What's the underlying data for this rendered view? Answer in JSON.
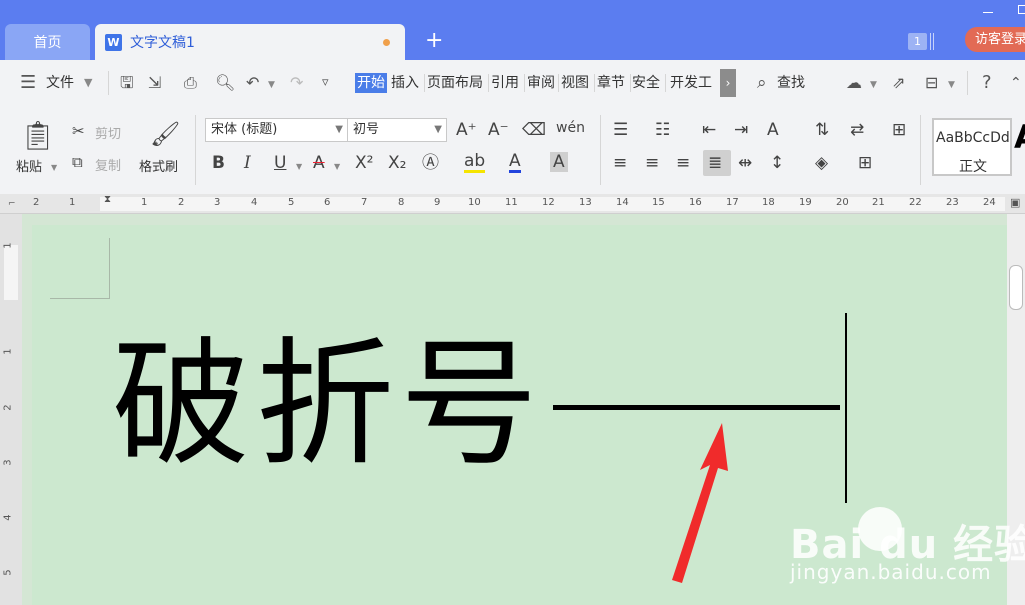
{
  "titlebar": {
    "tab_home": "首页",
    "tab_doc": "文字文稿1",
    "tab_doc_icon": "W",
    "add_tab": "+",
    "window_count": "1",
    "guest_login": "访客登录",
    "colors": {
      "bar": "#5b7df0",
      "tab_active": "#f2f3f5",
      "guest": "#e26a55"
    }
  },
  "menubar": {
    "file": "文件",
    "tabs": [
      "开始",
      "插入",
      "页面布局",
      "引用",
      "审阅",
      "视图",
      "章节",
      "安全",
      "开发工"
    ],
    "active_tab": "开始",
    "more": "›",
    "find": "查找"
  },
  "ribbon": {
    "paste": "粘贴",
    "cut": "剪切",
    "copy": "复制",
    "format_painter": "格式刷",
    "font_name": "宋体 (标题)",
    "font_size": "初号",
    "style_sample": "AaBbCcDd",
    "style_name": "正文",
    "style_next_glyph": "A"
  },
  "ruler": {
    "h_ticks": [
      "2",
      "1",
      "1",
      "2",
      "3",
      "4",
      "5",
      "6",
      "7",
      "8",
      "9",
      "10",
      "11",
      "12",
      "13",
      "14",
      "15",
      "16",
      "17",
      "18",
      "19",
      "20",
      "21",
      "22",
      "23",
      "24"
    ],
    "v_ticks": [
      "1",
      "1",
      "2",
      "3",
      "4",
      "5"
    ]
  },
  "document": {
    "text": "破折号",
    "dash": "——",
    "page_color": "#cce8cf"
  },
  "watermark": {
    "logo": "Bai du 经验",
    "url": "jingyan.baidu.com"
  },
  "annotation": {
    "arrow_color": "#f02b2b"
  }
}
